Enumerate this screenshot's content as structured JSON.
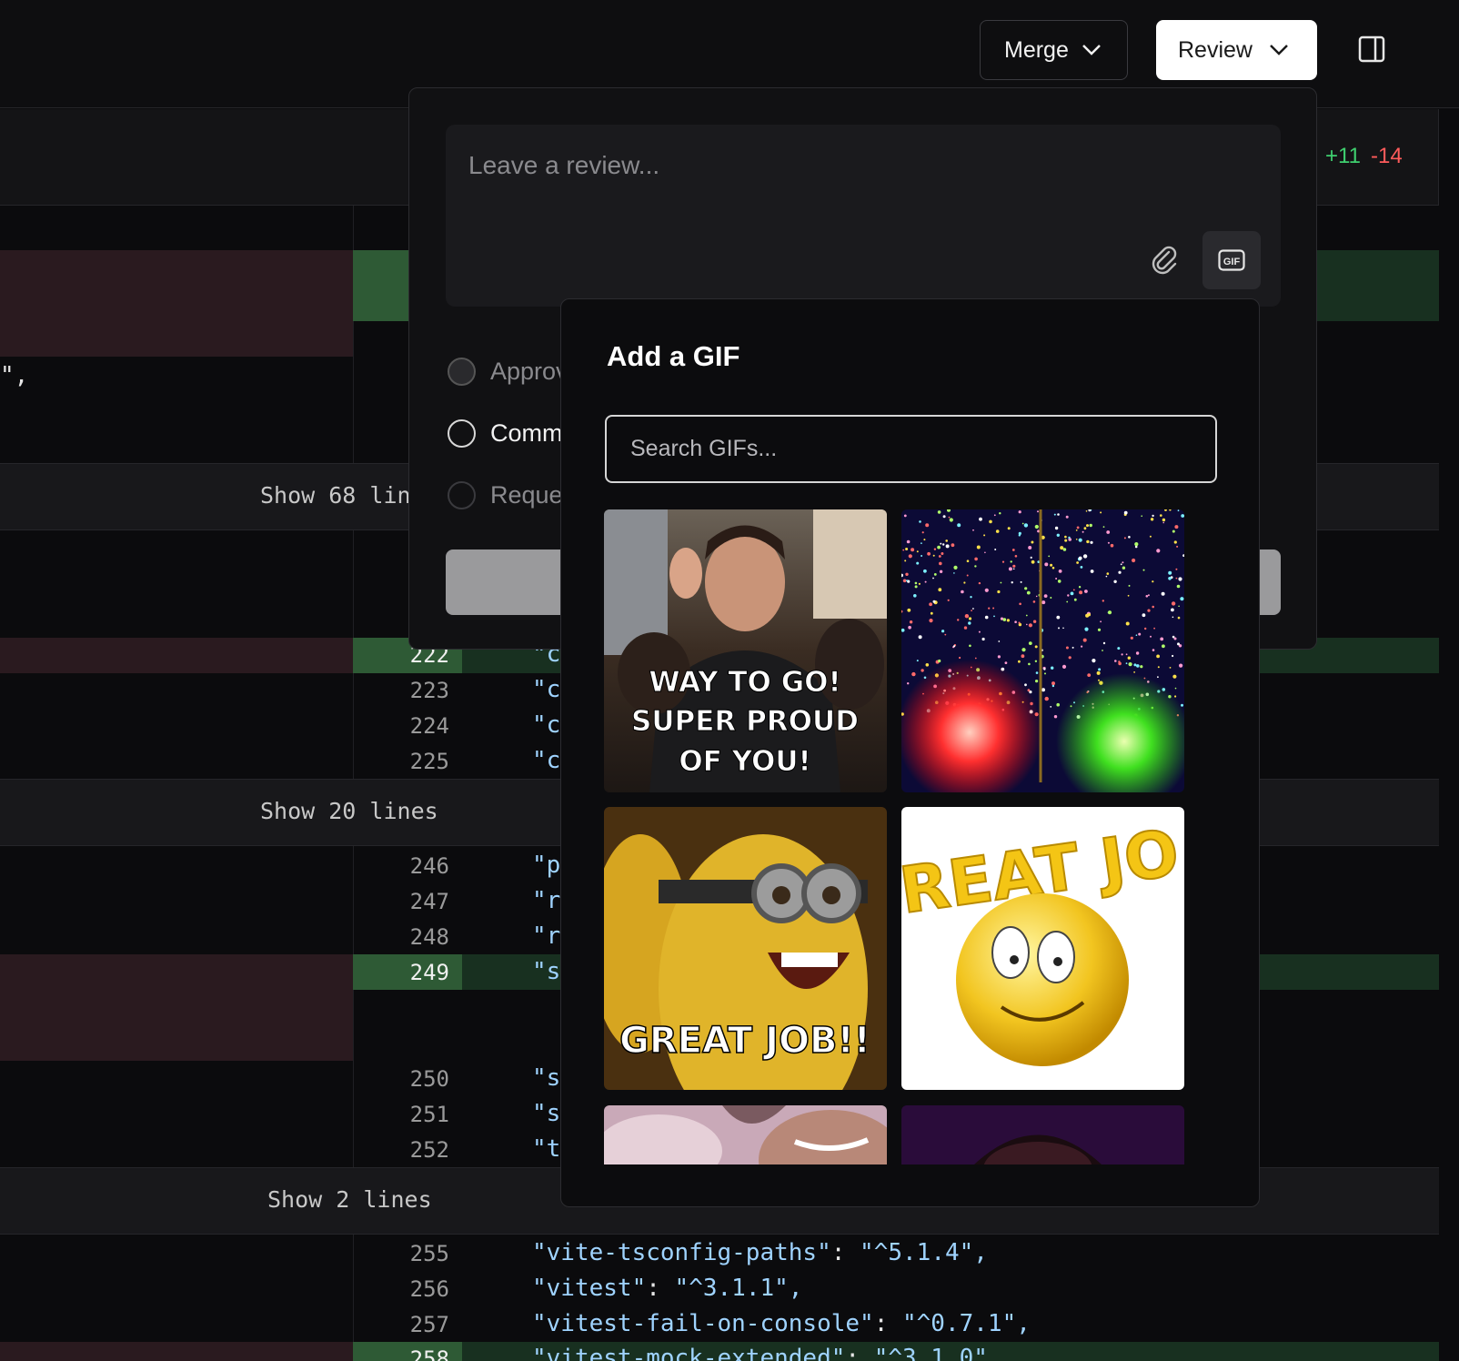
{
  "header": {
    "merge_label": "Merge",
    "review_label": "Review"
  },
  "file_header": {
    "additions": "+11",
    "deletions": "-14"
  },
  "diff": {
    "stray_text": "\",",
    "expand_rows": [
      "Show 68 lines",
      "Show 20 lines",
      "Show 2 lines"
    ],
    "line_numbers": [
      "222",
      "223",
      "224",
      "225",
      "246",
      "247",
      "248",
      "249",
      "250",
      "251",
      "252",
      "255",
      "256",
      "257",
      "258"
    ],
    "code_fragments": [
      "\"c",
      "\"c",
      "\"c",
      "\"c",
      "\"p",
      "\"r",
      "\"r",
      "\"s",
      "\"s",
      "\"s",
      "\"t"
    ],
    "full_lines": [
      {
        "key": "\"vite-tsconfig-paths\"",
        "value": "\"^5.1.4\","
      },
      {
        "key": "\"vitest\"",
        "value": "\"^3.1.1\","
      },
      {
        "key": "\"vitest-fail-on-console\"",
        "value": "\"^0.7.1\","
      },
      {
        "key": "\"vitest-mock-extended\"",
        "value": "\"^3.1.0\""
      }
    ]
  },
  "review": {
    "placeholder": "Leave a review...",
    "options": [
      "Approv",
      "Comm",
      "Reque"
    ]
  },
  "gif_picker": {
    "title": "Add a GIF",
    "search_placeholder": "Search GIFs...",
    "gifs": [
      {
        "caption": "WAY TO GO! SUPER PROUD OF YOU!",
        "line1": "WAY TO GO!",
        "line2": "SUPER PROUD",
        "line3": "OF YOU!"
      },
      {
        "caption": ""
      },
      {
        "caption": "GREAT JOB!!"
      },
      {
        "caption": "REAT JO"
      },
      {
        "caption": ""
      },
      {
        "caption": ""
      }
    ]
  },
  "colors": {
    "additions": "#3fcf6f",
    "deletions": "#ff5b5b",
    "added_row": "#183020",
    "deleted_row": "#2a1a1f"
  }
}
